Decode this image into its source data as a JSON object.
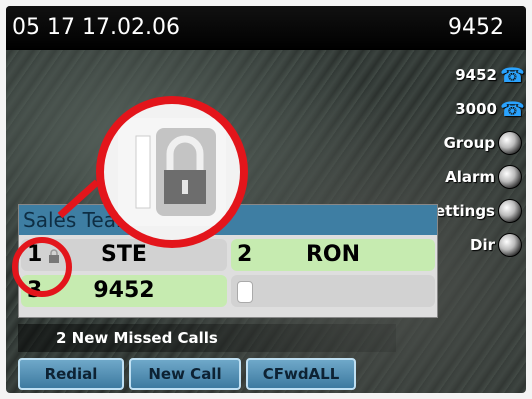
{
  "status_bar": {
    "datetime": "05 17 17.02.06",
    "extension": "9452"
  },
  "line_keys": [
    {
      "label": "9452",
      "icon": "phone-icon"
    },
    {
      "label": "3000",
      "icon": "phone-icon"
    },
    {
      "label": "Group",
      "icon": "globe-icon"
    },
    {
      "label": "Alarm",
      "icon": "globe-icon"
    },
    {
      "label": "Group Settings",
      "icon": "globe-icon"
    },
    {
      "label": "Dir",
      "icon": "globe-icon"
    }
  ],
  "sales_panel": {
    "title": "Sales Team",
    "cells": [
      {
        "num": "1",
        "name": "STE",
        "locked": true,
        "color": "#d2d2d2"
      },
      {
        "num": "2",
        "name": "RON",
        "locked": false,
        "color": "#c6ebb0"
      },
      {
        "num": "3",
        "name": "9452",
        "locked": false,
        "color": "#c6ebb0"
      },
      {
        "num": "",
        "name": "",
        "locked": false,
        "color": "#d2d2d2"
      }
    ]
  },
  "missed_calls": "2 New Missed Calls",
  "softkeys": [
    "Redial",
    "New Call",
    "CFwdALL"
  ],
  "colors": {
    "highlight_ring": "#e3151b",
    "header_blue": "#3e7ea3",
    "softkey_blue": "#5a93b7"
  }
}
